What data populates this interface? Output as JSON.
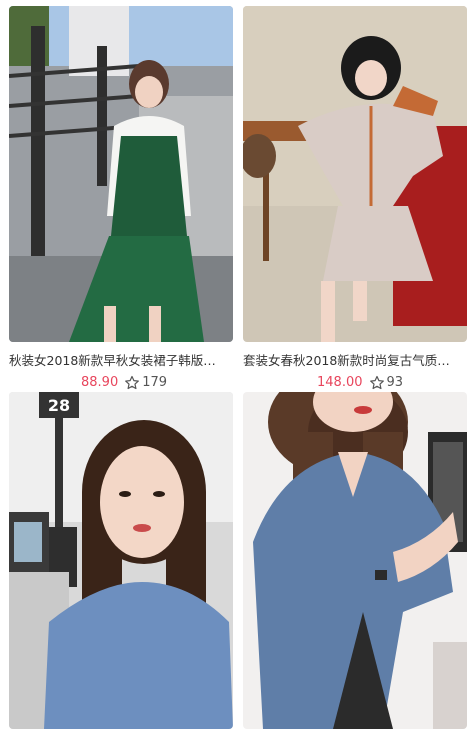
{
  "colors": {
    "price": "#e8465d",
    "text": "#333333",
    "muted": "#555555"
  },
  "products": [
    {
      "title": "秋装女2018新款早秋女装裙子韩版…",
      "price": "88.90",
      "favorites": "179",
      "icon": "star-outline-icon"
    },
    {
      "title": "套装女春秋2018新款时尚复古气质…",
      "price": "148.00",
      "favorites": "93",
      "icon": "star-outline-icon"
    },
    {
      "title": "",
      "price": "",
      "favorites": "",
      "icon": "star-outline-icon"
    },
    {
      "title": "",
      "price": "",
      "favorites": "",
      "icon": "star-outline-icon"
    }
  ],
  "photo_signage": {
    "number": "28"
  }
}
